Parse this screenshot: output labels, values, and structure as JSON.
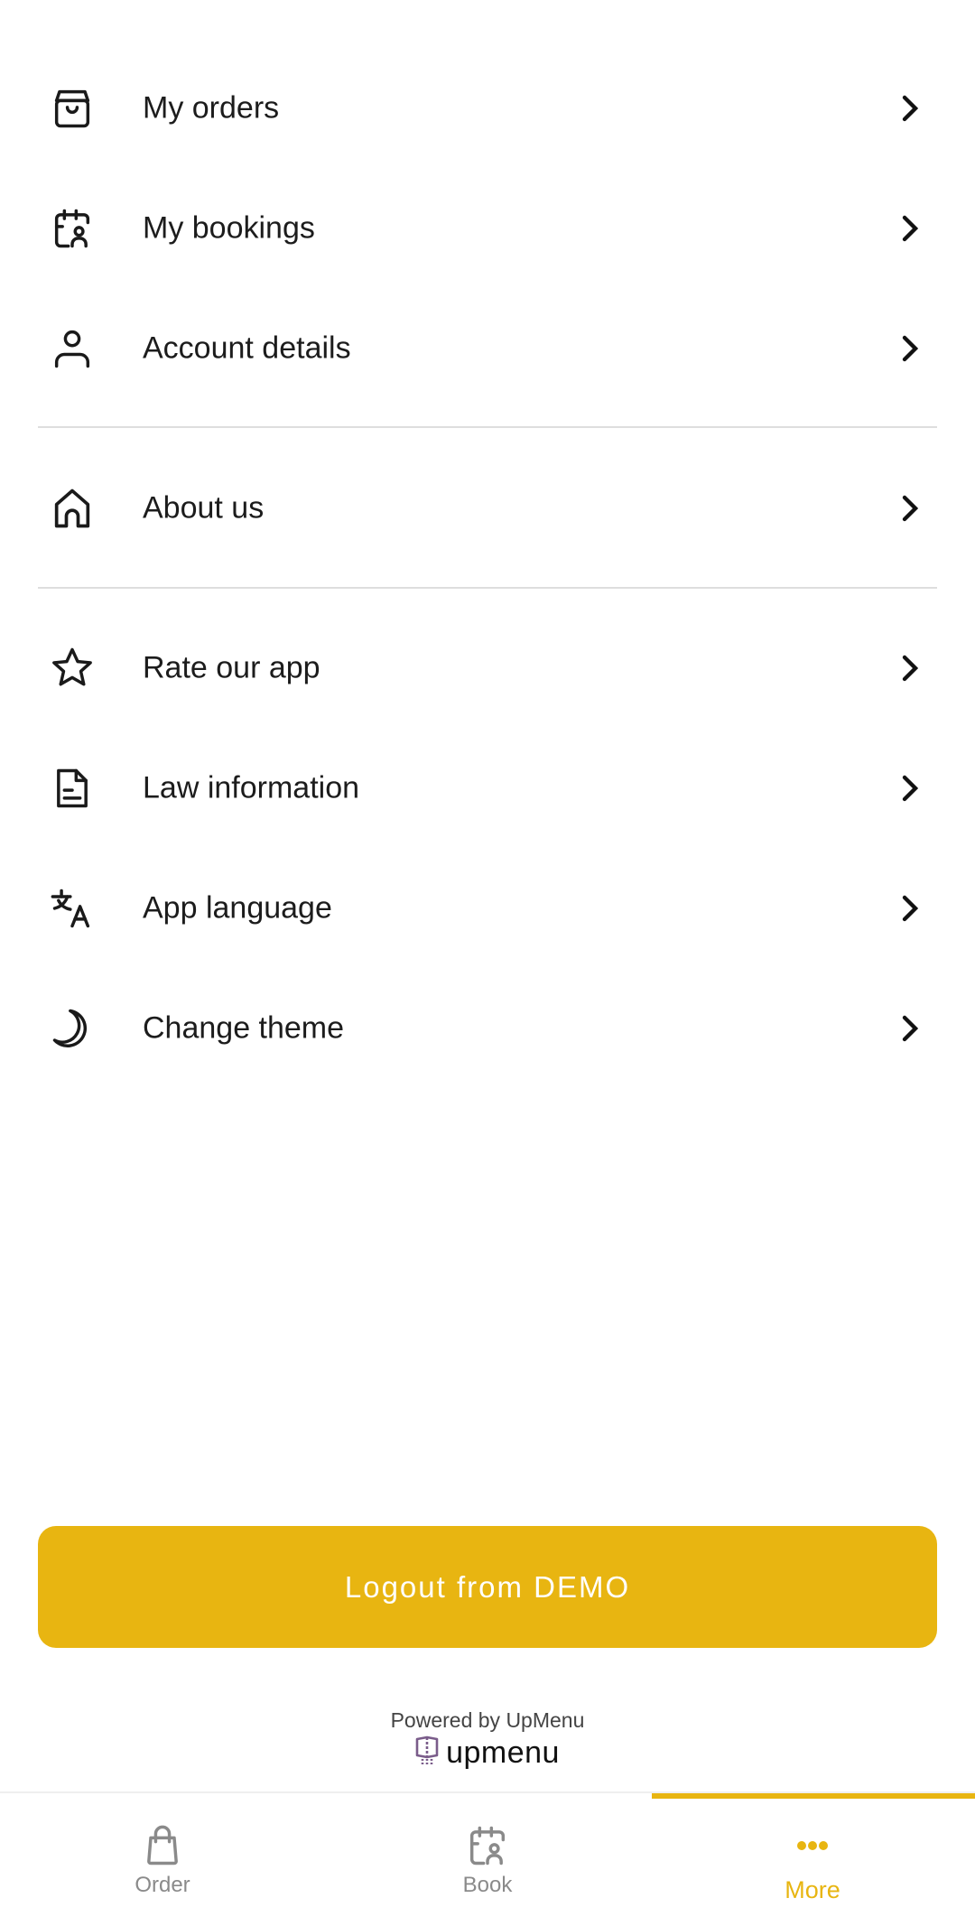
{
  "menu": {
    "items": [
      {
        "label": "My orders",
        "icon": "shopping-bag-icon"
      },
      {
        "label": "My bookings",
        "icon": "calendar-user-icon"
      },
      {
        "label": "Account details",
        "icon": "user-icon"
      },
      {
        "label": "About us",
        "icon": "home-icon"
      },
      {
        "label": "Rate our app",
        "icon": "star-icon"
      },
      {
        "label": "Law information",
        "icon": "document-icon"
      },
      {
        "label": "App language",
        "icon": "translate-icon"
      },
      {
        "label": "Change theme",
        "icon": "moon-icon"
      }
    ]
  },
  "logout": {
    "label": "Logout from DEMO"
  },
  "footer": {
    "powered_by": "Powered by UpMenu",
    "brand": "upmenu"
  },
  "bottom_nav": {
    "items": [
      {
        "label": "Order",
        "icon": "shopping-bag-icon",
        "active": false
      },
      {
        "label": "Book",
        "icon": "calendar-user-icon",
        "active": false
      },
      {
        "label": "More",
        "icon": "more-dots-icon",
        "active": true
      }
    ]
  },
  "colors": {
    "accent": "#E8B511",
    "text": "#1c1c1c",
    "inactive": "#8a8a8a",
    "divider": "#dedede",
    "brand_logo": "#7a5c8a"
  }
}
